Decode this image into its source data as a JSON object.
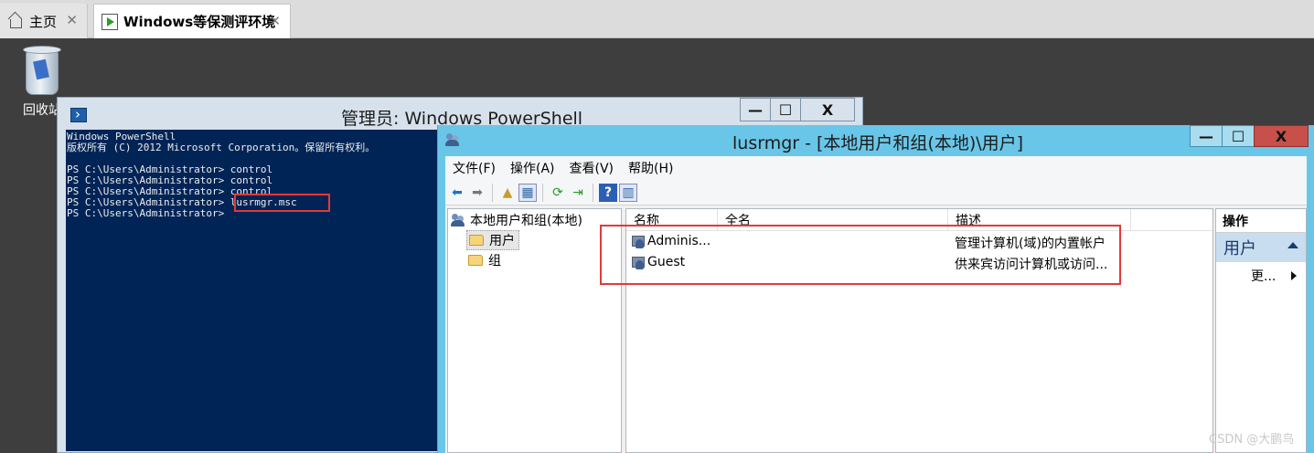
{
  "host_tabs": [
    {
      "label": "主页"
    },
    {
      "label": "Windows等保测评环境"
    }
  ],
  "tab_close_glyph": "✕",
  "desktop": {
    "recycle_bin_label": "回收站"
  },
  "powershell": {
    "title": "管理员: Windows PowerShell",
    "controls": {
      "minimize": "—",
      "maximize": "☐",
      "close": "X"
    },
    "lines": [
      "Windows PowerShell",
      "版权所有 (C) 2012 Microsoft Corporation。保留所有权利。",
      "",
      "PS C:\\Users\\Administrator> control",
      "PS C:\\Users\\Administrator> control",
      "PS C:\\Users\\Administrator> control",
      "PS C:\\Users\\Administrator> lusrmgr.msc",
      "PS C:\\Users\\Administrator>"
    ]
  },
  "mmc": {
    "title": "lusrmgr - [本地用户和组(本地)\\用户]",
    "controls": {
      "minimize": "—",
      "maximize": "☐",
      "close": "X"
    },
    "menu": [
      "文件(F)",
      "操作(A)",
      "查看(V)",
      "帮助(H)"
    ],
    "tree": {
      "root": "本地用户和组(本地)",
      "children": [
        "用户",
        "组"
      ]
    },
    "columns": [
      "名称",
      "全名",
      "描述"
    ],
    "rows": [
      {
        "name": "Adminis...",
        "full_name": "",
        "description": "管理计算机(域)的内置帐户"
      },
      {
        "name": "Guest",
        "full_name": "",
        "description": "供来宾访问计算机或访问..."
      }
    ],
    "actions": {
      "header": "操作",
      "section": "用户",
      "more": "更..."
    }
  },
  "watermark": "CSDN @大鹏鸟",
  "colors": {
    "console_bg": "#012456",
    "mmc_frame": "#69c6e8",
    "highlight_box": "#e03a3a"
  }
}
